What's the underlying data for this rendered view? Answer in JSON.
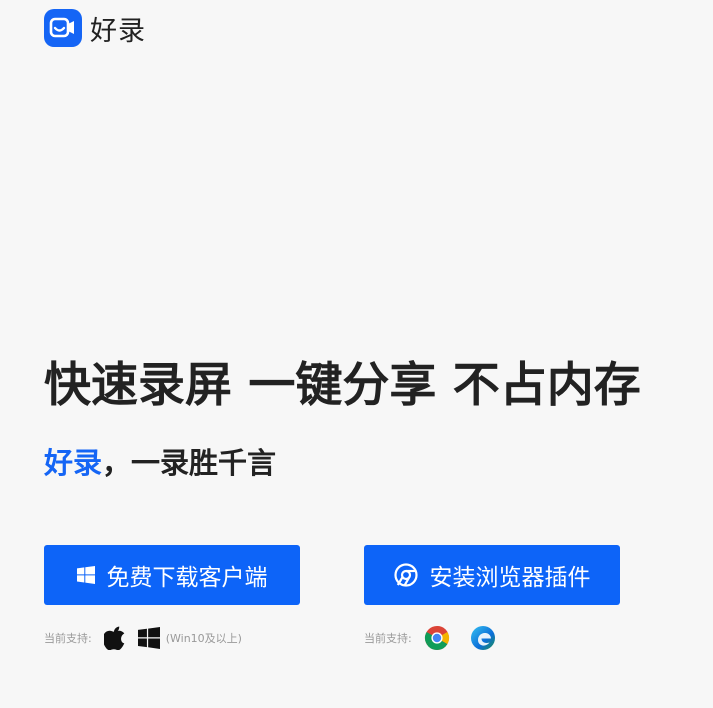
{
  "header": {
    "logo_text": "好录"
  },
  "hero": {
    "headline": "快速录屏 一键分享 不占内存",
    "subhead_brand": "好录",
    "subhead_rest": "，一录胜千言"
  },
  "actions": {
    "download_client_label": "免费下载客户端",
    "install_plugin_label": "安装浏览器插件"
  },
  "support": {
    "client_label": "当前支持:",
    "client_note": "(Win10及以上)",
    "plugin_label": "当前支持:"
  },
  "icons": {
    "logo": "camera-smile-icon",
    "windows": "windows-icon",
    "chrome": "chrome-icon",
    "apple": "apple-icon",
    "edge": "edge-icon"
  },
  "colors": {
    "brand": "#1565f5",
    "button": "#0d64f8",
    "background": "#f7f7f7",
    "text": "#222222"
  }
}
